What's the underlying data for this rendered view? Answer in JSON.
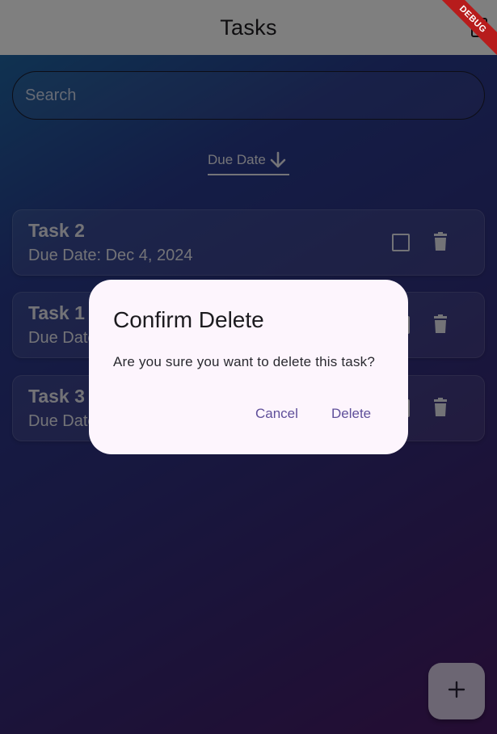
{
  "appbar": {
    "title": "Tasks",
    "action_icon": "square-icon",
    "debug_banner": "DEBUG"
  },
  "search": {
    "placeholder": "Search"
  },
  "sort": {
    "label": "Due Date",
    "direction_icon": "arrow-down-icon"
  },
  "tasks": [
    {
      "title": "Task 2",
      "due": "Due Date: Dec 4, 2024",
      "completed": false
    },
    {
      "title": "Task 1",
      "due": "Due Date",
      "completed": false
    },
    {
      "title": "Task 3",
      "due": "Due Date",
      "completed": false
    }
  ],
  "dialog": {
    "title": "Confirm Delete",
    "message": "Are you sure you want to delete this task?",
    "cancel_label": "Cancel",
    "delete_label": "Delete"
  },
  "fab": {
    "icon": "plus-icon"
  },
  "colors": {
    "accent": "#5f4f9a",
    "dialog_bg": "#fdf5fd",
    "fab_bg": "#d8cde6",
    "debug_banner": "#b71c1c"
  }
}
